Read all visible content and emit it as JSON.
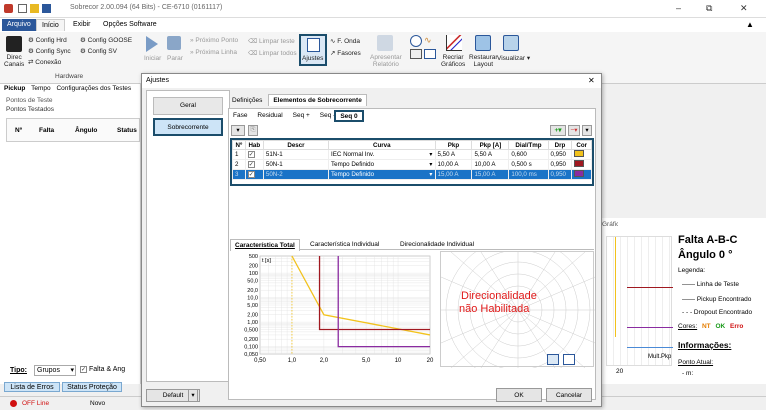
{
  "window": {
    "title": "Sobrecor 2.00.094 (64 Bits) - CE-6710 (0161117)",
    "minimize": "–",
    "maximize": "⧉",
    "close": "✕"
  },
  "menu": {
    "tabs": [
      "Arquivo",
      "Início",
      "Exibir",
      "Opções Software"
    ]
  },
  "ribbon": {
    "direc_canais": [
      "Direc",
      "Canais"
    ],
    "config_hrd": "Config Hrd",
    "config_sync": "Config Sync",
    "conexao": "Conexão",
    "config_goose": "Config GOOSE",
    "config_sv": "Config SV",
    "hardware_group": "Hardware",
    "iniciar": "Iniciar",
    "parar": "Parar",
    "proximo_ponto": "Próximo Ponto",
    "proxima_linha": "Próxima Linha",
    "limpar_teste": "Limpar teste",
    "limpar_todos": "Limpar todos",
    "ajustes": "Ajustes",
    "f_onda": "F. Onda",
    "fasores": "Fasores",
    "apresentar_relatorio": [
      "Apresentar",
      "Relatório"
    ],
    "recriar_graficos": [
      "Recriar",
      "Gráficos"
    ],
    "restaurar_layout": [
      "Restaurar",
      "Layout"
    ],
    "visualizar": "Visualizar"
  },
  "left_pane": {
    "tabs": [
      "Pickup",
      "Tempo",
      "Configurações dos Testes"
    ],
    "pontos_de_teste": "Pontos de Teste",
    "pontos_testados": "Pontos Testados",
    "columns": [
      "Nº",
      "Falta",
      "Ângulo",
      "Status"
    ],
    "tipo_label": "Tipo:",
    "tipo_value": "Grupos",
    "falta_ang": "Falta & Ang",
    "bottom_tabs": [
      "Lista de Erros",
      "Status Proteção"
    ]
  },
  "right_pane": {
    "tab": "Gráfico",
    "falta": "Falta A-B-C",
    "angulo": "Ângulo 0 °",
    "legenda": "Legenda:",
    "linha_teste": "Linha de Teste",
    "pickup_encontrado": "Pickup Encontrado",
    "dropout_encontrado": "Dropout Encontrado",
    "cores": "Cores:",
    "nt": "NT",
    "ok": "OK",
    "erro": "Erro",
    "informacoes": "Informações:",
    "ponto_atual": "Ponto Atual:",
    "m": "- m:",
    "axis_20": "20",
    "mult_pkp": "Mult.Pkp"
  },
  "status": {
    "offline": "OFF Line",
    "novo": "Novo"
  },
  "dialog": {
    "title": "Ajustes",
    "close": "✕",
    "side": [
      "Geral",
      "Sobrecorrente"
    ],
    "top_tabs": [
      "Definições",
      "Elementos de Sobrecorrente"
    ],
    "sub_tabs": [
      "Fase",
      "Residual",
      "Seq +",
      "Seq -",
      "Seq 0"
    ],
    "columns": [
      "Nº",
      "Hab",
      "Descr",
      "Curva",
      "Pkp",
      "Pkp [A]",
      "Dial/Tmp",
      "Drp",
      "Cor"
    ],
    "rows": [
      {
        "n": "1",
        "hab": "✓",
        "descr": "51N-1",
        "curva": "IEC Normal Inv.",
        "pkp": "5,50 A",
        "pkpa": "5,50 A",
        "dial": "0,600",
        "drp": "0,950",
        "cor": "#f2c21c"
      },
      {
        "n": "2",
        "hab": "✓",
        "descr": "50N-1",
        "curva": "Tempo Definido",
        "pkp": "10,00 A",
        "pkpa": "10,00 A",
        "dial": "0,500 s",
        "drp": "0,950",
        "cor": "#a01820"
      },
      {
        "n": "3",
        "hab": "✓",
        "descr": "50N-2",
        "curva": "Tempo Definido",
        "pkp": "15,00 A",
        "pkpa": "15,00 A",
        "dial": "100,0 ms",
        "drp": "0,950",
        "cor": "#8a2ba0"
      }
    ],
    "chart_tabs": [
      "Característica Total",
      "Característica Individual",
      "Direcionalidade Individual"
    ],
    "t_label": "t [s]",
    "dir_text": [
      "Direcionalidade",
      "não Habilitada"
    ],
    "default_btn": "Default",
    "ok_btn": "OK",
    "cancel_btn": "Cancelar"
  },
  "chart_data": {
    "type": "line",
    "xscale": "log",
    "yscale": "log",
    "x_ticks": [
      "0,50",
      "1,0",
      "2,0",
      "5,0",
      "10",
      "20"
    ],
    "y_ticks": [
      "500",
      "200",
      "100",
      "50,0",
      "20,0",
      "10,0",
      "5,00",
      "2,00",
      "1,00",
      "0,500",
      "0,200",
      "0,100",
      "0,050"
    ],
    "ylabel": "t [s]",
    "series": [
      {
        "color": "#f2c21c",
        "x": [
          1.0,
          2.0,
          20
        ],
        "y": [
          500,
          2.0,
          0.3
        ]
      },
      {
        "color": "#a01820",
        "x": [
          1.82,
          1.82,
          20
        ],
        "y": [
          500,
          0.5,
          0.5
        ]
      },
      {
        "color": "#8a2ba0",
        "x": [
          2.73,
          2.73,
          20
        ],
        "y": [
          500,
          0.1,
          0.1
        ]
      }
    ]
  }
}
